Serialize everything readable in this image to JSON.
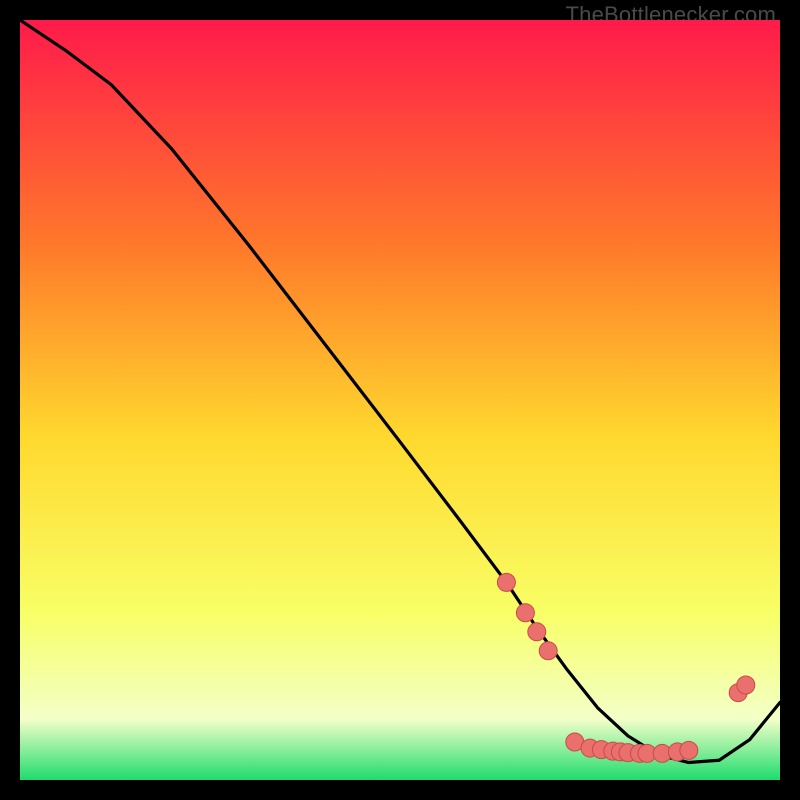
{
  "watermark": "TheBottlenecker.com",
  "colors": {
    "gradient_top": "#ff1a4b",
    "gradient_mid_upper": "#ff7a2a",
    "gradient_mid": "#ffd92e",
    "gradient_mid_lower": "#f8ff66",
    "gradient_pale": "#f3ffc8",
    "gradient_bottom": "#1fdc6e",
    "curve": "#000000",
    "marker_fill": "#e9706d",
    "marker_stroke": "#c94b49",
    "frame": "#000000"
  },
  "chart_data": {
    "type": "line",
    "title": "",
    "xlabel": "",
    "ylabel": "",
    "xlim": [
      0,
      100
    ],
    "ylim": [
      0,
      100
    ],
    "curve": {
      "x": [
        0,
        6,
        12,
        20,
        30,
        40,
        50,
        58,
        64,
        68,
        72,
        76,
        80,
        84,
        88,
        92,
        96,
        100
      ],
      "y": [
        100,
        96,
        91.5,
        83,
        70.5,
        57.5,
        44.5,
        34,
        26,
        20,
        14.5,
        9.5,
        5.8,
        3.3,
        2.3,
        2.6,
        5.3,
        10.2
      ]
    },
    "markers": [
      {
        "x": 64.0,
        "y": 26.0
      },
      {
        "x": 66.5,
        "y": 22.0
      },
      {
        "x": 68.0,
        "y": 19.5
      },
      {
        "x": 69.5,
        "y": 17.0
      },
      {
        "x": 73.0,
        "y": 5.0
      },
      {
        "x": 75.0,
        "y": 4.2
      },
      {
        "x": 76.5,
        "y": 4.0
      },
      {
        "x": 78.0,
        "y": 3.8
      },
      {
        "x": 79.0,
        "y": 3.7
      },
      {
        "x": 80.0,
        "y": 3.6
      },
      {
        "x": 81.5,
        "y": 3.5
      },
      {
        "x": 82.5,
        "y": 3.5
      },
      {
        "x": 84.5,
        "y": 3.5
      },
      {
        "x": 86.5,
        "y": 3.7
      },
      {
        "x": 88.0,
        "y": 3.9
      },
      {
        "x": 94.5,
        "y": 11.5
      },
      {
        "x": 95.5,
        "y": 12.5
      }
    ]
  }
}
